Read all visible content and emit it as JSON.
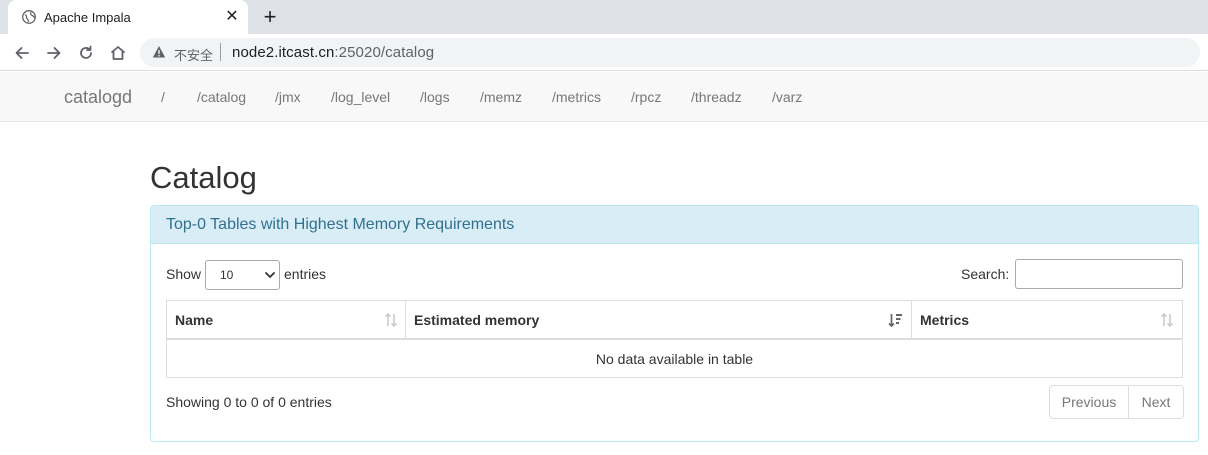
{
  "browser": {
    "tab_title": "Apache Impala",
    "tab_close": "✕",
    "new_tab": "+",
    "insecure_label": "不安全",
    "url_host": "node2.itcast.cn",
    "url_rest": ":25020/catalog",
    "icons": [
      "globe-icon",
      "close-icon",
      "plus-icon",
      "back-icon",
      "forward-icon",
      "reload-icon",
      "home-icon",
      "warning-icon"
    ]
  },
  "navbar": {
    "brand": "catalogd",
    "links": [
      "/",
      "/catalog",
      "/jmx",
      "/log_level",
      "/logs",
      "/memz",
      "/metrics",
      "/rpcz",
      "/threadz",
      "/varz"
    ]
  },
  "page": {
    "title": "Catalog"
  },
  "panel": {
    "heading": "Top-0 Tables with Highest Memory Requirements",
    "show_label": "Show",
    "length_value": "10",
    "entries_label": "entries",
    "search_label": "Search:",
    "search_value": "",
    "columns": [
      "Name",
      "Estimated memory",
      "Metrics"
    ],
    "empty_text": "No data available in table",
    "info": "Showing 0 to 0 of 0 entries",
    "prev_label": "Previous",
    "next_label": "Next"
  },
  "colors": {
    "panel_heading_bg": "#d9edf7",
    "panel_heading_text": "#31708f",
    "panel_border": "#bce8f1",
    "navbar_bg": "#f8f8f8"
  }
}
